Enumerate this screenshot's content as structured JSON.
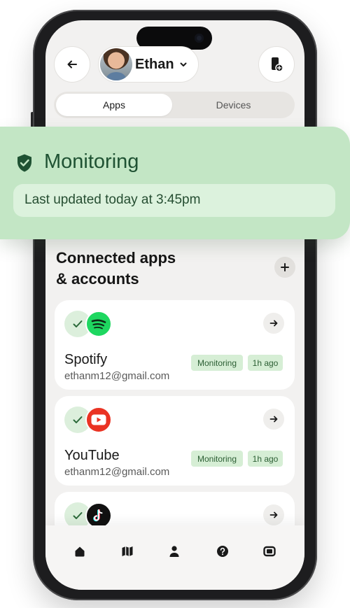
{
  "header": {
    "profile_name": "Ethan"
  },
  "tabs": [
    {
      "label": "Apps",
      "active": true
    },
    {
      "label": "Devices",
      "active": false
    }
  ],
  "monitor": {
    "title": "Monitoring",
    "subtitle": "Last updated today at 3:45pm",
    "color": "#c3e6c5"
  },
  "section": {
    "title_line1": "Connected apps",
    "title_line2": "& accounts"
  },
  "apps": [
    {
      "name": "Spotify",
      "email": "ethanm12@gmail.com",
      "status": "Monitoring",
      "time": "1h ago",
      "icon": "spotify-icon",
      "brand_color": "#1ed760"
    },
    {
      "name": "YouTube",
      "email": "ethanm12@gmail.com",
      "status": "Monitoring",
      "time": "1h ago",
      "icon": "youtube-icon",
      "brand_color": "#ea3323"
    },
    {
      "name": "",
      "email": "",
      "status": "",
      "time": "",
      "icon": "tiktok-icon",
      "brand_color": "#111111"
    }
  ],
  "bottom_nav": [
    "home-icon",
    "map-icon",
    "person-icon",
    "help-icon",
    "device-icon"
  ],
  "colors": {
    "accent_green": "#1f5233",
    "badge_bg": "#d6eed5",
    "screen_bg": "#f2f1f0"
  }
}
